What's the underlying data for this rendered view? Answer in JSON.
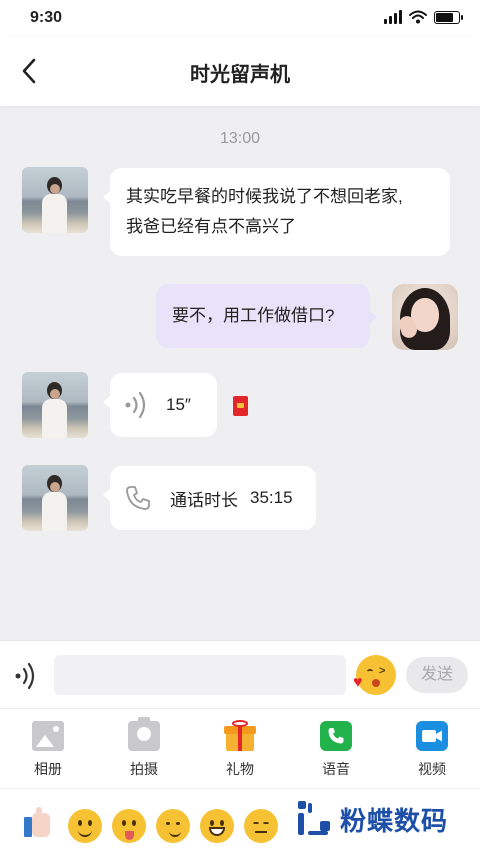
{
  "status_bar": {
    "time": "9:30"
  },
  "header": {
    "title": "时光留声机"
  },
  "timestamp": "13:00",
  "messages": {
    "m1": {
      "text_line1": "其实吃早餐的时候我说了不想回老家,",
      "text_line2": "我爸已经有点不高兴了"
    },
    "m2": {
      "text": "要不，用工作做借口?"
    },
    "m3": {
      "duration": "15″"
    },
    "m4": {
      "label": "通话时长",
      "duration": "35:15"
    }
  },
  "input_bar": {
    "placeholder": "",
    "send_label": "发送"
  },
  "toolbar": {
    "album": "相册",
    "camera": "拍摄",
    "gift": "礼物",
    "voice": "语音",
    "video": "视频"
  },
  "watermark": {
    "text": "粉蝶数码"
  },
  "colors": {
    "own_bubble": "#e9e3f9",
    "voice_green": "#22b24c",
    "video_blue": "#1a8fe0",
    "gift_orange": "#f6b132",
    "watermark_blue": "#1d4fa8"
  }
}
